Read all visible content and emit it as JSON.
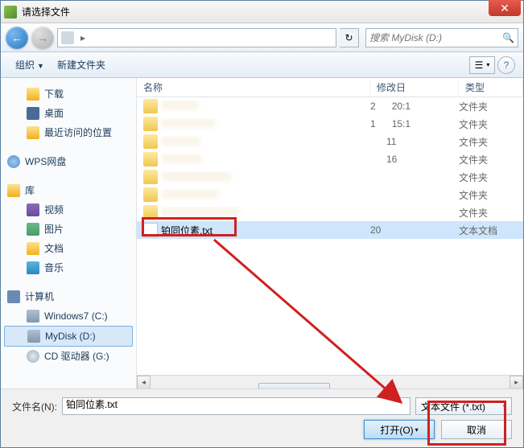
{
  "window": {
    "title": "请选择文件"
  },
  "nav": {
    "search_placeholder": "搜索 MyDisk (D:)"
  },
  "toolbar": {
    "organize": "组织",
    "newfolder": "新建文件夹"
  },
  "sidebar": {
    "downloads": "下载",
    "desktop": "桌面",
    "recent": "最近访问的位置",
    "wps": "WPS网盘",
    "library": "库",
    "video": "视频",
    "pictures": "图片",
    "documents": "文档",
    "music": "音乐",
    "computer": "计算机",
    "windows7": "Windows7 (C:)",
    "mydisk": "MyDisk (D:)",
    "cddrive": "CD 驱动器 (G:)"
  },
  "columns": {
    "name": "名称",
    "date": "修改日",
    "type": "类型"
  },
  "files": [
    {
      "name": "",
      "date_a": "2",
      "date_b": "20:1",
      "type": "文件夹"
    },
    {
      "name": "",
      "date_a": "1",
      "date_b": "15:1",
      "type": "文件夹"
    },
    {
      "name": "",
      "date_a": "",
      "date_b": "11",
      "type": "文件夹"
    },
    {
      "name": "",
      "date_a": "",
      "date_b": "16",
      "type": "文件夹"
    },
    {
      "name": "",
      "date_a": "",
      "date_b": "",
      "type": "文件夹"
    },
    {
      "name": "",
      "date_a": "",
      "date_b": "",
      "type": "文件夹"
    },
    {
      "name": "",
      "date_a": "",
      "date_b": "",
      "type": "文件夹"
    }
  ],
  "selected_file": {
    "name": "铂同位素.txt",
    "date_a": "20",
    "date_b": "",
    "type": "文本文档"
  },
  "footer": {
    "filename_label": "文件名(N):",
    "filename_value": "铂同位素.txt",
    "filter": "文本文件 (*.txt)",
    "open": "打开(O)",
    "cancel": "取消"
  }
}
